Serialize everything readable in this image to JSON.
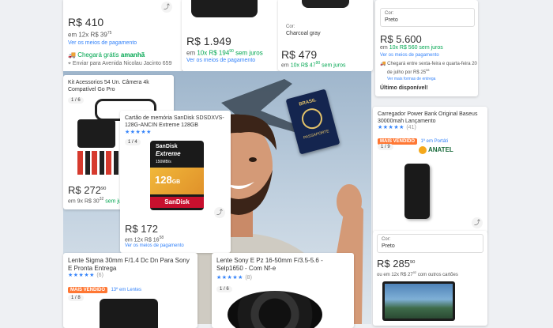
{
  "colors": {
    "accent": "#3483fa",
    "green": "#00a650",
    "badge": "#ff7733",
    "star": "#3483fa"
  },
  "card_top_left": {
    "price_main": "R$ 410",
    "installments": "em 12x R$ 39",
    "installments_cents": "75",
    "payment_link": "Ver os meios de pagamento",
    "shipping": "Chegará grátis",
    "shipping_bold": "amanhã",
    "address": "Enviar para Avenida Nicolau Jacinto 659"
  },
  "card_top_mid": {
    "price_main": "R$ 1.949",
    "installments_prefix": "em",
    "installments_green": "10x R$ 194",
    "installments_cents": "90",
    "installments_suffix": "sem juros",
    "payment_link": "Ver os meios de pagamento"
  },
  "card_top_charcoal": {
    "color_label": "Cor:",
    "color_value": "Charcoal gray",
    "price_main": "R$ 479",
    "installments_prefix": "em",
    "installments_green": "10x R$ 47",
    "installments_cents": "90",
    "installments_suffix": "sem juros"
  },
  "card_top_right": {
    "color_label": "Cor:",
    "color_value": "Preto",
    "price_main": "R$ 5.600",
    "installments_prefix": "em",
    "installments_green": "10x R$ 560 sem juros",
    "payment_link": "Ver os meios de pagamento",
    "shipping_line1": "Chegará entre sexta-feira e quarta-feira 20",
    "shipping_line2": "de julho por R$ 25",
    "shipping_cents": "08",
    "shipping_link": "Ver mais formas de entrega",
    "stock": "Último disponível!"
  },
  "card_kit": {
    "title": "Kit Acessorios 54 Un. Câmera 4k Compatível Go Pro",
    "counter": "1 / 6",
    "price_main": "R$ 272",
    "price_cents": "90",
    "installments": "em 9x R$ 30",
    "installments_cents": "32",
    "installments_suffix": "sem juros"
  },
  "card_sd": {
    "title": "Cartão de memória SanDisk SDSDXVS-128G-ANCIN Extreme 128GB",
    "stars": "★★★★★",
    "rating_count": "",
    "counter": "1 / 4",
    "sd_brand": "SanDisk",
    "sd_line": "Extreme",
    "sd_speed": "150MB/s",
    "sd_cap": "128",
    "sd_unit": "GB",
    "sd_logo": "SanDisk",
    "price_main": "R$ 172",
    "installments": "em 12x R$ 16",
    "installments_cents": "58",
    "payment_link": "Ver os meios de pagamento"
  },
  "card_powerbank": {
    "title": "Carregador Power Bank Original Baseus 30000mah Lançamento",
    "stars": "★★★★★",
    "rating_count": "(41)",
    "badge": "MAIS VENDIDO",
    "badge_note": "1º em Portáti",
    "counter": "1 / 9",
    "seal": "ANATEL"
  },
  "card_laptop": {
    "color_label": "Cor:",
    "color_value": "Preto",
    "price_main": "R$ 285",
    "price_cents": "90",
    "installments": "ou em 12x R$ 27",
    "installments_cents": "02",
    "installments_suffix": "com outros cartões"
  },
  "card_sigma": {
    "title": "Lente Sigma 30mm F/1.4 Dc Dn Para Sony E Pronta Entrega",
    "stars": "★★★★★",
    "rating_count": "(6)",
    "badge": "MAIS VENDIDO",
    "badge_note": "13º em Lentes",
    "counter": "1 / 8"
  },
  "card_sony": {
    "title": "Lente Sony E Pz 16-50mm F/3.5-5.6 - Selp1650 - Com Nf-e",
    "stars": "★★★★★",
    "rating_count": "(8)",
    "counter": "1 / 6"
  },
  "photo": {
    "passport_country": "BRASIL",
    "passport_word": "PASSAPORTE"
  }
}
